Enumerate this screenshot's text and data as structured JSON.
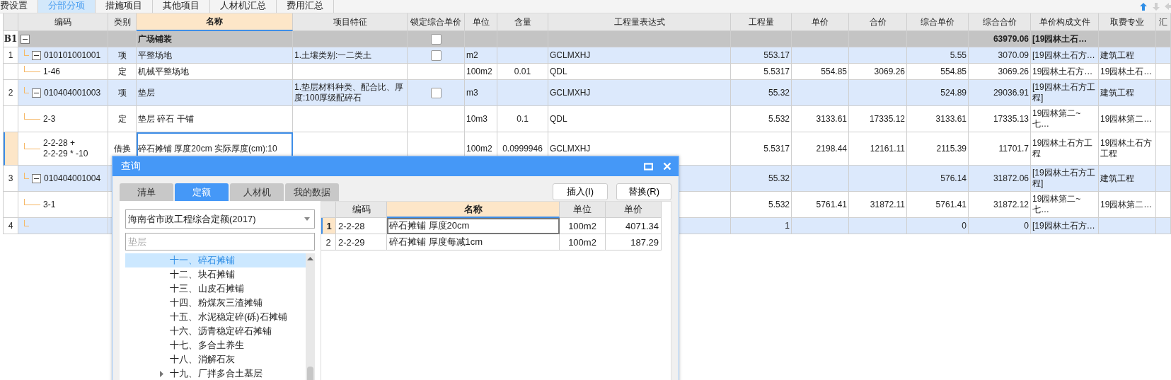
{
  "tabs": [
    {
      "label": "费设置",
      "selected": false
    },
    {
      "label": "分部分项",
      "selected": true
    },
    {
      "label": "措施项目",
      "selected": false
    },
    {
      "label": "其他项目",
      "selected": false
    },
    {
      "label": "人材机汇总",
      "selected": false
    },
    {
      "label": "费用汇总",
      "selected": false
    }
  ],
  "table": {
    "columns": [
      {
        "label": "编码",
        "selected": false
      },
      {
        "label": "类别",
        "selected": false
      },
      {
        "label": "名称",
        "selected": true
      },
      {
        "label": "项目特征",
        "selected": false
      },
      {
        "label": "锁定综合单价",
        "selected": false
      },
      {
        "label": "单位",
        "selected": false
      },
      {
        "label": "含量",
        "selected": false
      },
      {
        "label": "工程量表达式",
        "selected": false
      },
      {
        "label": "工程量",
        "selected": false
      },
      {
        "label": "单价",
        "selected": false
      },
      {
        "label": "合价",
        "selected": false
      },
      {
        "label": "综合单价",
        "selected": false
      },
      {
        "label": "综合合价",
        "selected": false
      },
      {
        "label": "单价构成文件",
        "selected": false
      },
      {
        "label": "取费专业",
        "selected": false
      },
      {
        "label": "汇",
        "selected": false
      }
    ],
    "rows": [
      {
        "index": "B1",
        "kind": "group",
        "selected": false,
        "expanded": true,
        "name": "广场铺装",
        "locked": false,
        "comp_total": "63979.06",
        "price_file": "[19园林土石…",
        "children": [
          {
            "index": "1",
            "kind": "item",
            "selected": false,
            "expanded": true,
            "code": "010101001001",
            "category": "项",
            "name": "平整场地",
            "features": "1.土壤类别:一二类土",
            "locked": false,
            "unit": "m2",
            "expression": "GCLMXHJ",
            "quantity": "553.17",
            "comp_unit_price": "5.55",
            "comp_total": "3070.09",
            "price_file": "[19园林土石方…",
            "fee_type": "建筑工程",
            "children": [
              {
                "kind": "sub",
                "selected": false,
                "code": "1-46",
                "category": "定",
                "name": "机械平整场地",
                "unit": "100m2",
                "content": "0.01",
                "expression": "QDL",
                "quantity": "5.5317",
                "unit_price": "554.85",
                "total": "3069.26",
                "comp_unit_price": "554.85",
                "comp_total": "3069.26",
                "price_file": "19园林土石方…",
                "fee_type": "19园林土石…"
              }
            ]
          },
          {
            "index": "2",
            "kind": "item",
            "selected": false,
            "expanded": true,
            "code": "010404001003",
            "category": "项",
            "name": "垫层",
            "features": "1.垫层材料种类、配合比、厚度:100厚级配碎石",
            "locked": false,
            "unit": "m3",
            "expression": "GCLMXHJ",
            "quantity": "55.32",
            "comp_unit_price": "524.89",
            "comp_total": "29036.91",
            "price_file": "[19园林土石方工程]",
            "fee_type": "建筑工程",
            "children": [
              {
                "kind": "sub",
                "selected": false,
                "code": "2-3",
                "category": "定",
                "name": "垫层 碎石 干铺",
                "unit": "10m3",
                "content": "0.1",
                "expression": "QDL",
                "quantity": "5.532",
                "unit_price": "3133.61",
                "total": "17335.12",
                "comp_unit_price": "3133.61",
                "comp_total": "17335.13",
                "price_file": "19园林第二~七…",
                "fee_type": "19园林第二…"
              },
              {
                "kind": "sub",
                "selected": true,
                "code": "2-2-28 +\n2-2-29 * -10",
                "category": "借换",
                "name": "碎石摊铺 厚度20cm  实际厚度(cm):10",
                "unit": "100m2",
                "content": "0.0999946",
                "expression": "GCLMXHJ",
                "quantity": "5.5317",
                "unit_price": "2198.44",
                "total": "12161.11",
                "comp_unit_price": "2115.39",
                "comp_total": "11701.7",
                "price_file": "19园林土石方工程",
                "fee_type": "19园林土石方工程"
              }
            ]
          },
          {
            "index": "3",
            "kind": "item",
            "selected": false,
            "expanded": true,
            "code": "010404001004",
            "quantity": "55.32",
            "comp_unit_price": "576.14",
            "comp_total": "31872.06",
            "price_file": "[19园林土石方工程]",
            "fee_type": "建筑工程",
            "children": [
              {
                "kind": "sub",
                "selected": false,
                "code": "3-1",
                "quantity": "5.532",
                "unit_price": "5761.41",
                "total": "31872.11",
                "comp_unit_price": "5761.41",
                "comp_total": "31872.12",
                "price_file": "19园林第二~七…",
                "fee_type": "19园林第二…"
              }
            ]
          },
          {
            "index": "4",
            "kind": "item",
            "selected": false,
            "quantity": "1",
            "comp_unit_price": "0",
            "comp_total": "0",
            "price_file": "[19园林土石方…"
          }
        ]
      }
    ]
  },
  "dialog": {
    "title": "查询",
    "tabs": [
      {
        "label": "清单",
        "selected": false
      },
      {
        "label": "定额",
        "selected": true
      },
      {
        "label": "人材机",
        "selected": false
      },
      {
        "label": "我的数据",
        "selected": false
      }
    ],
    "buttons": [
      "插入(I)",
      "替换(R)"
    ],
    "library": {
      "value": "海南省市政工程综合定额(2017)"
    },
    "search": {
      "placeholder": "垫层"
    },
    "chapters": [
      {
        "number": "十一、",
        "label": "碎石摊铺",
        "selected": true,
        "has_children": false
      },
      {
        "number": "十二、",
        "label": "块石摊铺",
        "selected": false,
        "has_children": false
      },
      {
        "number": "十三、",
        "label": "山皮石摊铺",
        "selected": false,
        "has_children": false
      },
      {
        "number": "十四、",
        "label": "粉煤灰三渣摊铺",
        "selected": false,
        "has_children": false
      },
      {
        "number": "十五、",
        "label": "水泥稳定碎(砾)石摊铺",
        "selected": false,
        "has_children": false
      },
      {
        "number": "十六、",
        "label": "沥青稳定碎石摊铺",
        "selected": false,
        "has_children": false
      },
      {
        "number": "十七、",
        "label": "多合土养生",
        "selected": false,
        "has_children": false
      },
      {
        "number": "十八、",
        "label": "消解石灰",
        "selected": false,
        "has_children": false
      },
      {
        "number": "十九、",
        "label": "厂拌多合土基层",
        "selected": false,
        "has_children": true
      }
    ],
    "results": {
      "columns": [
        {
          "label": "编码",
          "selected": false
        },
        {
          "label": "名称",
          "selected": true
        },
        {
          "label": "单位",
          "selected": false
        },
        {
          "label": "单价",
          "selected": false
        }
      ],
      "rows": [
        {
          "index": "1",
          "code": "2-2-28",
          "name": "碎石摊铺 厚度20cm",
          "unit": "100m2",
          "price": "4071.34",
          "selected": true
        },
        {
          "index": "2",
          "code": "2-2-29",
          "name": "碎石摊铺 厚度每减1cm",
          "unit": "100m2",
          "price": "187.29",
          "selected": false
        }
      ]
    }
  }
}
